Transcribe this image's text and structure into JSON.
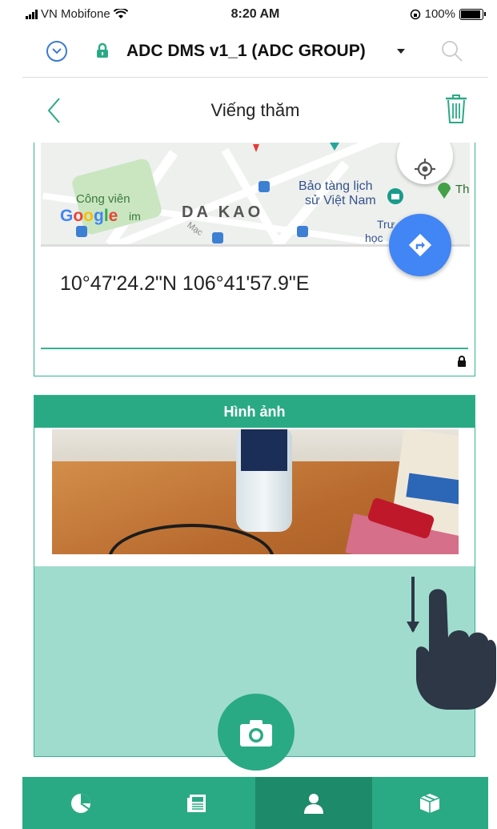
{
  "status_bar": {
    "carrier": "VN Mobifone",
    "time": "8:20 AM",
    "battery": "100%"
  },
  "app_bar": {
    "title": "ADC DMS v1_1 (ADC GROUP)"
  },
  "page_header": {
    "title": "Viếng thăm"
  },
  "map": {
    "labels": {
      "park": "Công viên",
      "park_suffix": "im",
      "museum_line1": "Bảo tàng lịch",
      "museum_line2": "sử Việt Nam",
      "district": "DA KAO",
      "school": "Trư",
      "school2": "học",
      "th": "Th",
      "street": "Mạc"
    },
    "logo": "Google",
    "coordinates": "10°47'24.2\"N 106°41'57.9\"E"
  },
  "images_section": {
    "header": "Hình ảnh"
  },
  "tab_bar": {
    "tabs": [
      {
        "icon": "pie-chart-icon",
        "active": false
      },
      {
        "icon": "news-icon",
        "active": false
      },
      {
        "icon": "person-icon",
        "active": true
      },
      {
        "icon": "box-icon",
        "active": false
      }
    ]
  },
  "colors": {
    "accent": "#2aaa84",
    "accent_dark": "#1d8a69",
    "panel_bg": "#9fdccd",
    "link_blue": "#3a7bd5",
    "map_button": "#4285F4"
  }
}
